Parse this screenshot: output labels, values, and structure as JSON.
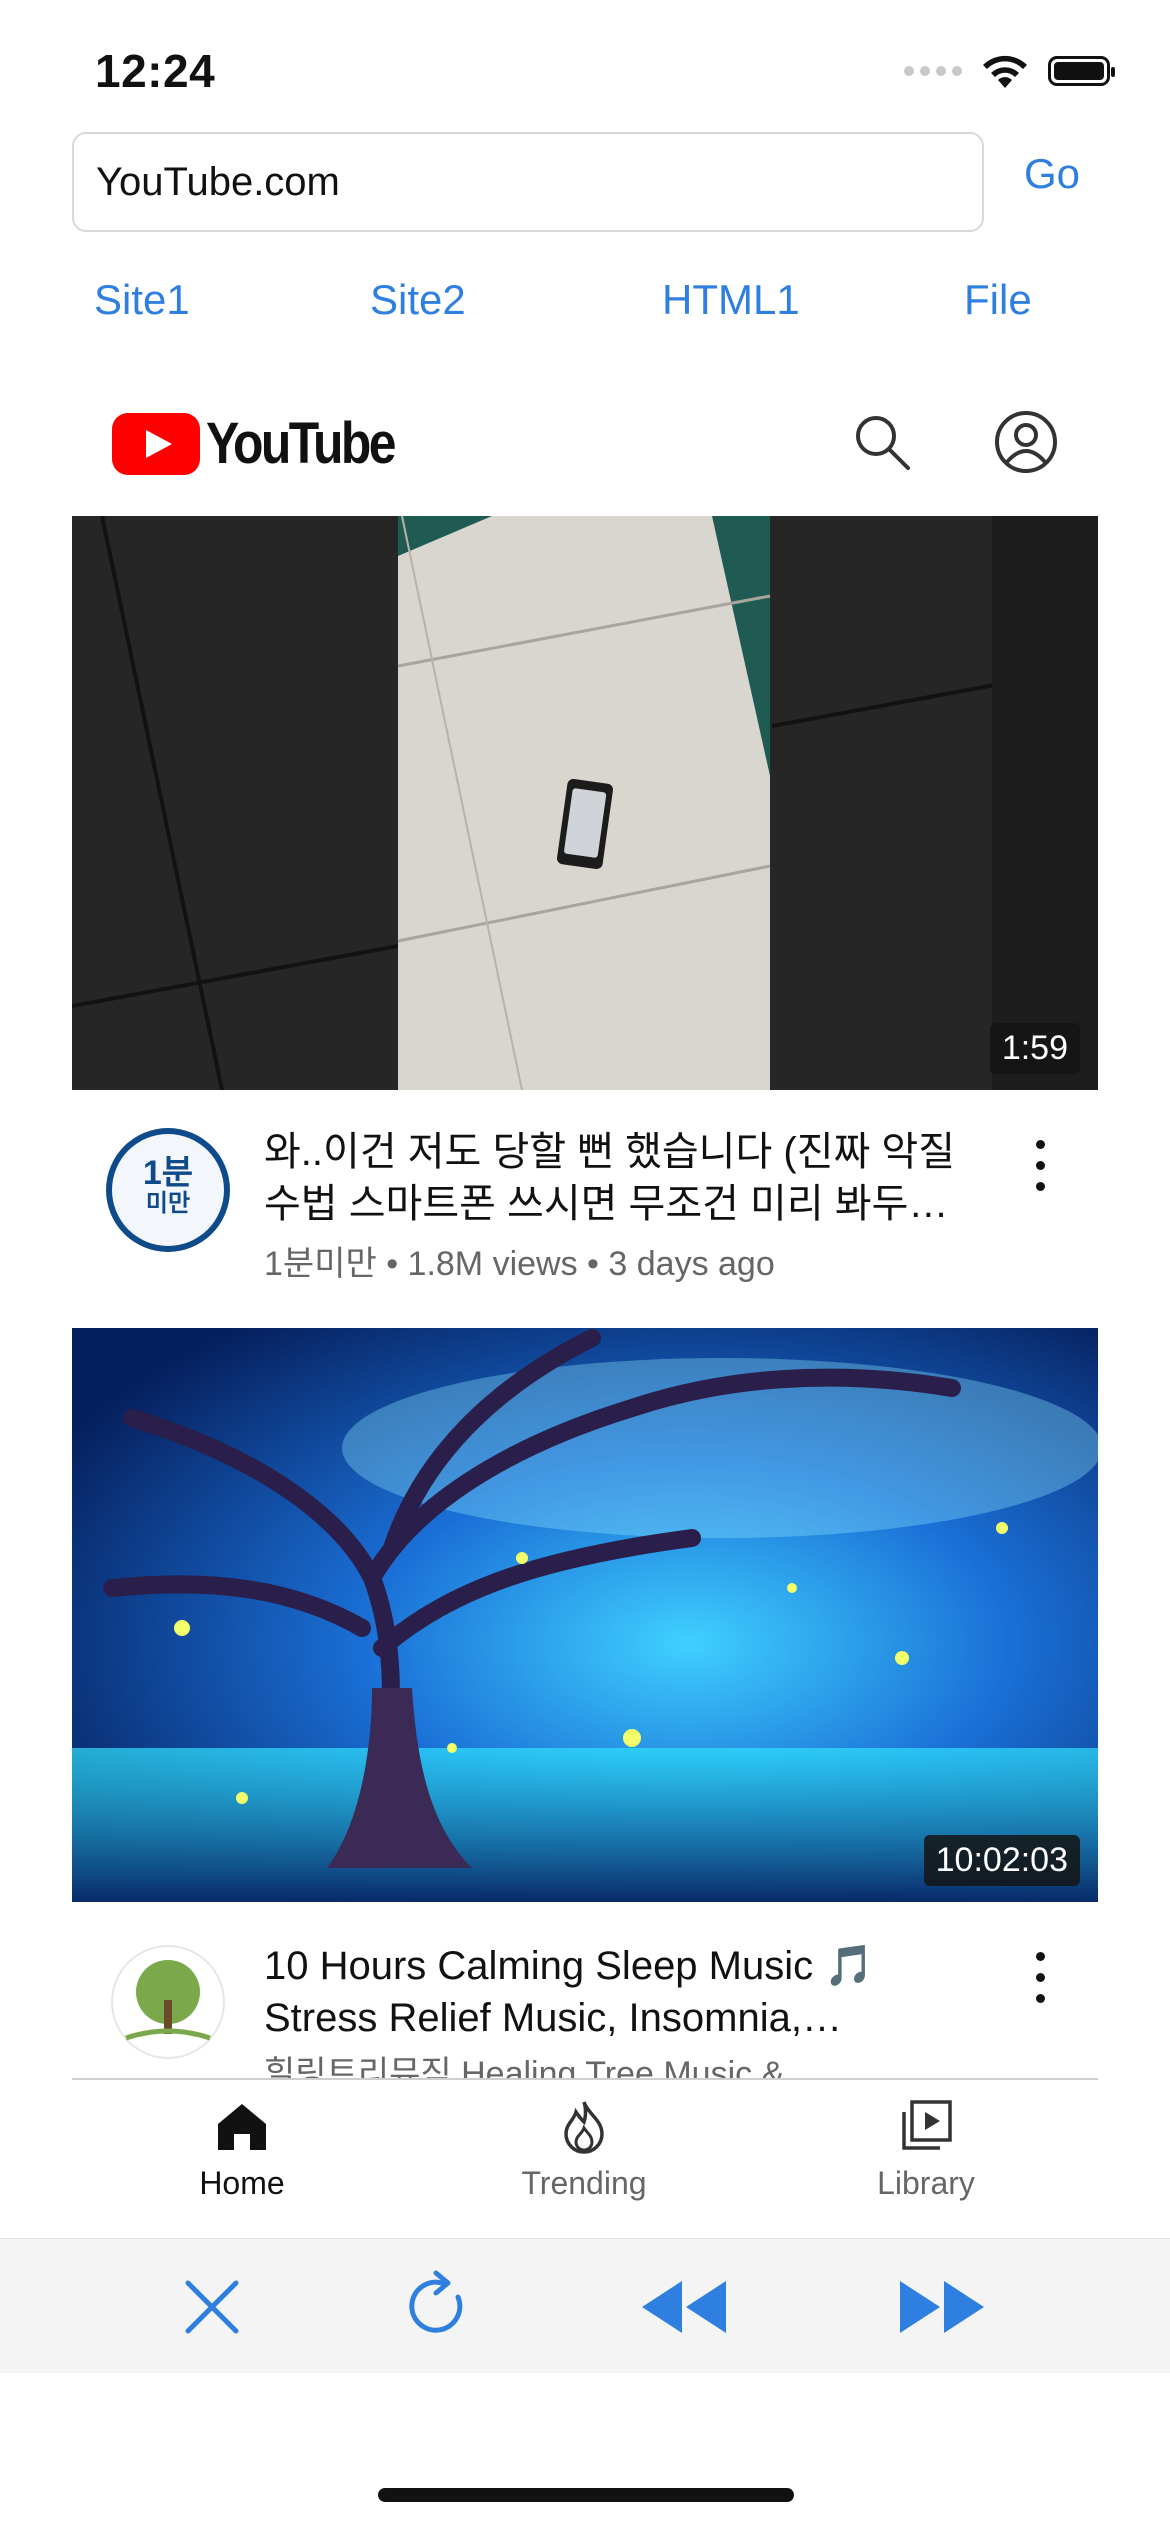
{
  "status_bar": {
    "time": "12:24"
  },
  "browser": {
    "url_value": "YouTube.com",
    "go_label": "Go",
    "quick_links": [
      "Site1",
      "Site2",
      "HTML1",
      "File"
    ]
  },
  "youtube": {
    "logo_text": "YouTube",
    "videos": [
      {
        "duration": "1:59",
        "avatar_line1": "1분",
        "avatar_line2": "미만",
        "title": "와..이건 저도 당할 뻔 했습니다 (진짜 악질 수법 스마트폰 쓰시면 무조건 미리 봐두…",
        "meta": "1분미만 • 1.8M views • 3 days ago"
      },
      {
        "duration": "10:02:03",
        "title": "10 Hours Calming Sleep Music 🎵 Stress Relief Music, Insomnia,…",
        "meta": "힐링트리뮤직 Healing Tree Music &"
      }
    ],
    "nav": [
      {
        "label": "Home",
        "icon": "home-icon",
        "active": true
      },
      {
        "label": "Trending",
        "icon": "flame-icon",
        "active": false
      },
      {
        "label": "Library",
        "icon": "library-icon",
        "active": false
      }
    ]
  },
  "toolbar": {
    "icons": [
      "close-icon",
      "reload-icon",
      "back-icon",
      "forward-icon"
    ],
    "accent": "#2f7fe0"
  },
  "colors": {
    "link": "#2f7fe0",
    "youtube_red": "#ff0000"
  }
}
